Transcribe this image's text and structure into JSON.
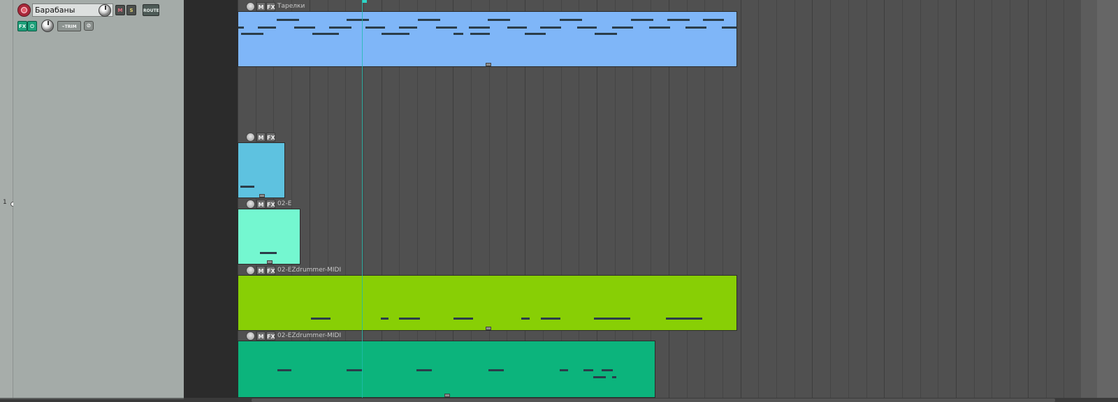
{
  "track_panel": {
    "track_number": "1",
    "track_name": "Барабаны",
    "mute_label": "M",
    "solo_label": "S",
    "route_label": "ROUTE",
    "fx_label": "FX",
    "fx_bypass_label": "⏻",
    "trim_label": "TRIM",
    "trim_icon": "envelope-icon",
    "io_icon": "io-icon",
    "arm_color": "#c03040",
    "fx_color": "#1ea07a"
  },
  "items": [
    {
      "name": "Тарелки",
      "color": "#7fb6f8",
      "m_label": "M",
      "fx_label": "FX"
    },
    {
      "name": "",
      "color": "#5ec2e0",
      "m_label": "M",
      "fx_label": "FX"
    },
    {
      "name": "02-E",
      "color": "#74f7d0",
      "m_label": "M",
      "fx_label": "FX"
    },
    {
      "name": "02-EZdrummer-MIDI",
      "color": "#88cf05",
      "m_label": "M",
      "fx_label": "FX"
    },
    {
      "name": "02-EZdrummer-MIDI",
      "color": "#0cb47c",
      "m_label": "M",
      "fx_label": "FX"
    }
  ],
  "colors": {
    "arrange_background": "#505050",
    "tcp_background": "#a4aba8",
    "playhead": "#1fbcae"
  }
}
